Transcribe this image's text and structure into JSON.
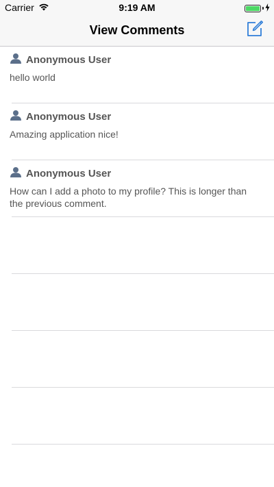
{
  "status_bar": {
    "carrier": "Carrier",
    "time": "9:19 AM",
    "battery_level": 1.0
  },
  "nav": {
    "title": "View Comments",
    "compose_icon": "compose-icon"
  },
  "comments": [
    {
      "user": "Anonymous User",
      "text": "hello world"
    },
    {
      "user": "Anonymous User",
      "text": "Amazing application nice!"
    },
    {
      "user": "Anonymous User",
      "text": "How can I add a photo to my profile? This is longer than the previous comment."
    }
  ],
  "colors": {
    "accent": "#2f7ed8",
    "avatar": "#5b6f8a",
    "text": "#555555",
    "separator": "#d9d9dc",
    "battery": "#4cd964"
  }
}
